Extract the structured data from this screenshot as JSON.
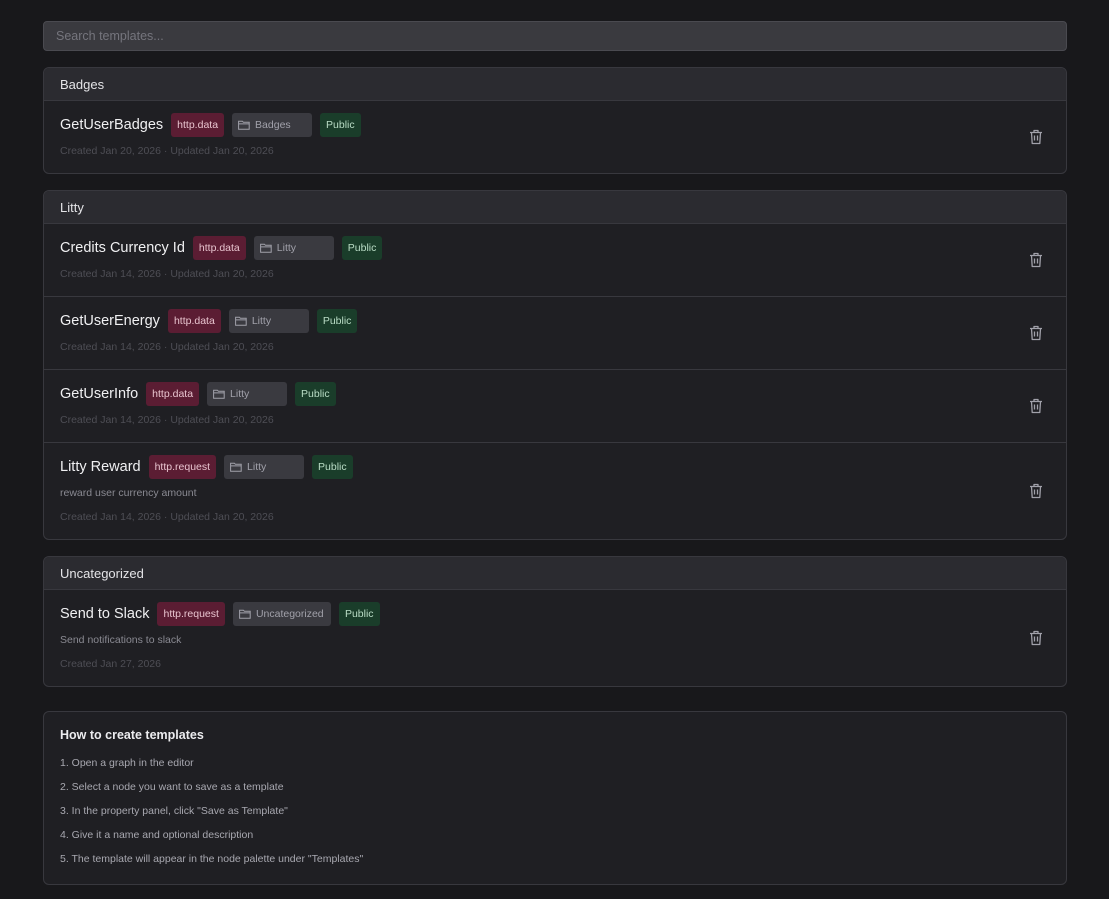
{
  "search": {
    "placeholder": "Search templates..."
  },
  "groups": [
    {
      "title": "Badges",
      "items": [
        {
          "name": "GetUserBadges",
          "type": "http.data",
          "folder": "Badges",
          "visibility": "Public",
          "description": "",
          "meta": "Created Jan 20, 2026 · Updated Jan 20, 2026"
        }
      ]
    },
    {
      "title": "Litty",
      "items": [
        {
          "name": "Credits Currency Id",
          "type": "http.data",
          "folder": "Litty",
          "visibility": "Public",
          "description": "",
          "meta": "Created Jan 14, 2026 · Updated Jan 20, 2026"
        },
        {
          "name": "GetUserEnergy",
          "type": "http.data",
          "folder": "Litty",
          "visibility": "Public",
          "description": "",
          "meta": "Created Jan 14, 2026 · Updated Jan 20, 2026"
        },
        {
          "name": "GetUserInfo",
          "type": "http.data",
          "folder": "Litty",
          "visibility": "Public",
          "description": "",
          "meta": "Created Jan 14, 2026 · Updated Jan 20, 2026"
        },
        {
          "name": "Litty Reward",
          "type": "http.request",
          "folder": "Litty",
          "visibility": "Public",
          "description": "reward user currency amount",
          "meta": "Created Jan 14, 2026 · Updated Jan 20, 2026"
        }
      ]
    },
    {
      "title": "Uncategorized",
      "items": [
        {
          "name": "Send to Slack",
          "type": "http.request",
          "folder": "Uncategorized",
          "visibility": "Public",
          "description": "Send notifications to slack",
          "meta": "Created Jan 27, 2026"
        }
      ]
    }
  ],
  "help": {
    "title": "How to create templates",
    "steps": [
      "1. Open a graph in the editor",
      "2. Select a node you want to save as a template",
      "3. In the property panel, click \"Save as Template\"",
      "4. Give it a name and optional description",
      "5. The template will appear in the node palette under \"Templates\""
    ]
  },
  "icons": {
    "folder": "folder-icon",
    "delete": "trash-icon"
  },
  "colors": {
    "background": "#18181b",
    "type_badge": "#5b1d33",
    "public_badge": "#1a3d2a",
    "folder_badge": "#3a3a40"
  }
}
